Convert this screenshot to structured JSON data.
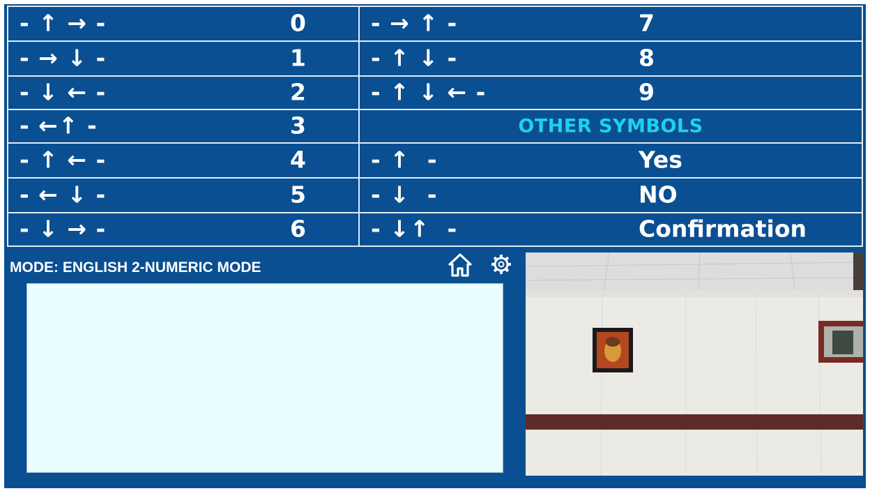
{
  "left_column": [
    {
      "arrows": "- ↑ → -",
      "code": "0"
    },
    {
      "arrows": "- → ↓ -",
      "code": "1"
    },
    {
      "arrows": "- ↓ ← -",
      "code": "2"
    },
    {
      "arrows": "- ←↑ -",
      "code": "3"
    },
    {
      "arrows": "- ↑ ← -",
      "code": "4"
    },
    {
      "arrows": "- ← ↓ -",
      "code": "5"
    },
    {
      "arrows": "- ↓ → -",
      "code": "6"
    }
  ],
  "right_column": {
    "numbers": [
      {
        "arrows": "- → ↑ -",
        "code": "7"
      },
      {
        "arrows": "- ↑ ↓ -",
        "code": "8"
      },
      {
        "arrows": "- ↑ ↓ ← -",
        "code": "9"
      }
    ],
    "other_header": "OTHER SYMBOLS",
    "symbols": [
      {
        "arrows": "- ↑  -",
        "code": "Yes"
      },
      {
        "arrows": "- ↓  -",
        "code": "NO"
      },
      {
        "arrows": "- ↓↑  -",
        "code": "Confirmation"
      }
    ]
  },
  "mode": {
    "label": "MODE: ENGLISH 2-NUMERIC MODE"
  },
  "icons": {
    "home": "home-icon",
    "settings": "gear-icon"
  },
  "text_area": {
    "value": ""
  },
  "colors": {
    "background": "#0a4f92",
    "cell_border": "#e4ecf4",
    "header_text": "#1fd0f2",
    "text_area_bg": "#e8fdfd"
  }
}
